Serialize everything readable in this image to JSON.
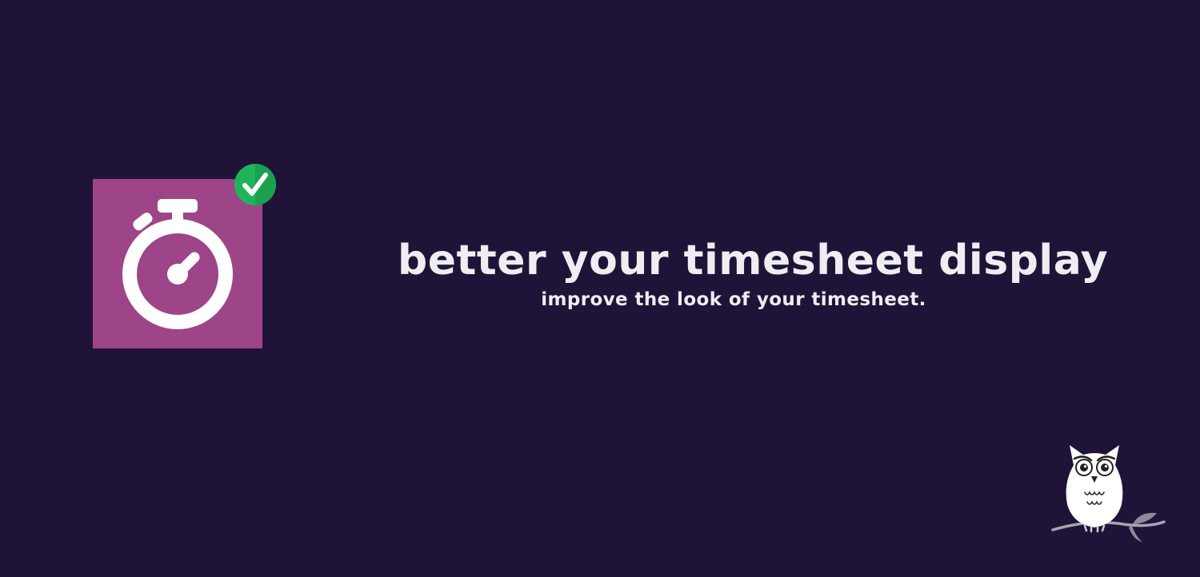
{
  "hero": {
    "title": "better your timesheet display",
    "subtitle": "improve the look of your timesheet."
  },
  "app_icon": {
    "icon": "stopwatch-icon",
    "background_color": "#9e4488",
    "icon_color": "#ffffff"
  },
  "status_badge": {
    "icon": "check-icon",
    "color": "#20b45a"
  },
  "brand_logo": {
    "icon": "owl-icon"
  },
  "colors": {
    "background": "#1f1438",
    "text": "#efedf1"
  }
}
